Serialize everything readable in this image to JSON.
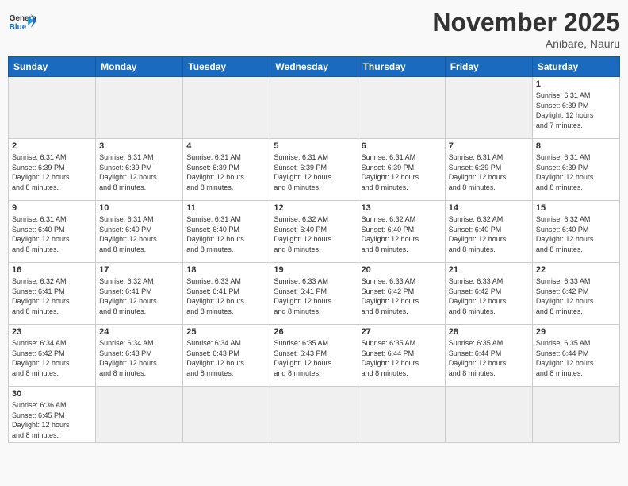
{
  "header": {
    "logo_general": "General",
    "logo_blue": "Blue",
    "month_title": "November 2025",
    "subtitle": "Anibare, Nauru"
  },
  "weekdays": [
    "Sunday",
    "Monday",
    "Tuesday",
    "Wednesday",
    "Thursday",
    "Friday",
    "Saturday"
  ],
  "weeks": [
    [
      {
        "day": "",
        "info": ""
      },
      {
        "day": "",
        "info": ""
      },
      {
        "day": "",
        "info": ""
      },
      {
        "day": "",
        "info": ""
      },
      {
        "day": "",
        "info": ""
      },
      {
        "day": "",
        "info": ""
      },
      {
        "day": "1",
        "info": "Sunrise: 6:31 AM\nSunset: 6:39 PM\nDaylight: 12 hours\nand 7 minutes."
      }
    ],
    [
      {
        "day": "2",
        "info": "Sunrise: 6:31 AM\nSunset: 6:39 PM\nDaylight: 12 hours\nand 8 minutes."
      },
      {
        "day": "3",
        "info": "Sunrise: 6:31 AM\nSunset: 6:39 PM\nDaylight: 12 hours\nand 8 minutes."
      },
      {
        "day": "4",
        "info": "Sunrise: 6:31 AM\nSunset: 6:39 PM\nDaylight: 12 hours\nand 8 minutes."
      },
      {
        "day": "5",
        "info": "Sunrise: 6:31 AM\nSunset: 6:39 PM\nDaylight: 12 hours\nand 8 minutes."
      },
      {
        "day": "6",
        "info": "Sunrise: 6:31 AM\nSunset: 6:39 PM\nDaylight: 12 hours\nand 8 minutes."
      },
      {
        "day": "7",
        "info": "Sunrise: 6:31 AM\nSunset: 6:39 PM\nDaylight: 12 hours\nand 8 minutes."
      },
      {
        "day": "8",
        "info": "Sunrise: 6:31 AM\nSunset: 6:39 PM\nDaylight: 12 hours\nand 8 minutes."
      }
    ],
    [
      {
        "day": "9",
        "info": "Sunrise: 6:31 AM\nSunset: 6:40 PM\nDaylight: 12 hours\nand 8 minutes."
      },
      {
        "day": "10",
        "info": "Sunrise: 6:31 AM\nSunset: 6:40 PM\nDaylight: 12 hours\nand 8 minutes."
      },
      {
        "day": "11",
        "info": "Sunrise: 6:31 AM\nSunset: 6:40 PM\nDaylight: 12 hours\nand 8 minutes."
      },
      {
        "day": "12",
        "info": "Sunrise: 6:32 AM\nSunset: 6:40 PM\nDaylight: 12 hours\nand 8 minutes."
      },
      {
        "day": "13",
        "info": "Sunrise: 6:32 AM\nSunset: 6:40 PM\nDaylight: 12 hours\nand 8 minutes."
      },
      {
        "day": "14",
        "info": "Sunrise: 6:32 AM\nSunset: 6:40 PM\nDaylight: 12 hours\nand 8 minutes."
      },
      {
        "day": "15",
        "info": "Sunrise: 6:32 AM\nSunset: 6:40 PM\nDaylight: 12 hours\nand 8 minutes."
      }
    ],
    [
      {
        "day": "16",
        "info": "Sunrise: 6:32 AM\nSunset: 6:41 PM\nDaylight: 12 hours\nand 8 minutes."
      },
      {
        "day": "17",
        "info": "Sunrise: 6:32 AM\nSunset: 6:41 PM\nDaylight: 12 hours\nand 8 minutes."
      },
      {
        "day": "18",
        "info": "Sunrise: 6:33 AM\nSunset: 6:41 PM\nDaylight: 12 hours\nand 8 minutes."
      },
      {
        "day": "19",
        "info": "Sunrise: 6:33 AM\nSunset: 6:41 PM\nDaylight: 12 hours\nand 8 minutes."
      },
      {
        "day": "20",
        "info": "Sunrise: 6:33 AM\nSunset: 6:42 PM\nDaylight: 12 hours\nand 8 minutes."
      },
      {
        "day": "21",
        "info": "Sunrise: 6:33 AM\nSunset: 6:42 PM\nDaylight: 12 hours\nand 8 minutes."
      },
      {
        "day": "22",
        "info": "Sunrise: 6:33 AM\nSunset: 6:42 PM\nDaylight: 12 hours\nand 8 minutes."
      }
    ],
    [
      {
        "day": "23",
        "info": "Sunrise: 6:34 AM\nSunset: 6:42 PM\nDaylight: 12 hours\nand 8 minutes."
      },
      {
        "day": "24",
        "info": "Sunrise: 6:34 AM\nSunset: 6:43 PM\nDaylight: 12 hours\nand 8 minutes."
      },
      {
        "day": "25",
        "info": "Sunrise: 6:34 AM\nSunset: 6:43 PM\nDaylight: 12 hours\nand 8 minutes."
      },
      {
        "day": "26",
        "info": "Sunrise: 6:35 AM\nSunset: 6:43 PM\nDaylight: 12 hours\nand 8 minutes."
      },
      {
        "day": "27",
        "info": "Sunrise: 6:35 AM\nSunset: 6:44 PM\nDaylight: 12 hours\nand 8 minutes."
      },
      {
        "day": "28",
        "info": "Sunrise: 6:35 AM\nSunset: 6:44 PM\nDaylight: 12 hours\nand 8 minutes."
      },
      {
        "day": "29",
        "info": "Sunrise: 6:35 AM\nSunset: 6:44 PM\nDaylight: 12 hours\nand 8 minutes."
      }
    ],
    [
      {
        "day": "30",
        "info": "Sunrise: 6:36 AM\nSunset: 6:45 PM\nDaylight: 12 hours\nand 8 minutes."
      },
      {
        "day": "",
        "info": ""
      },
      {
        "day": "",
        "info": ""
      },
      {
        "day": "",
        "info": ""
      },
      {
        "day": "",
        "info": ""
      },
      {
        "day": "",
        "info": ""
      },
      {
        "day": "",
        "info": ""
      }
    ]
  ]
}
